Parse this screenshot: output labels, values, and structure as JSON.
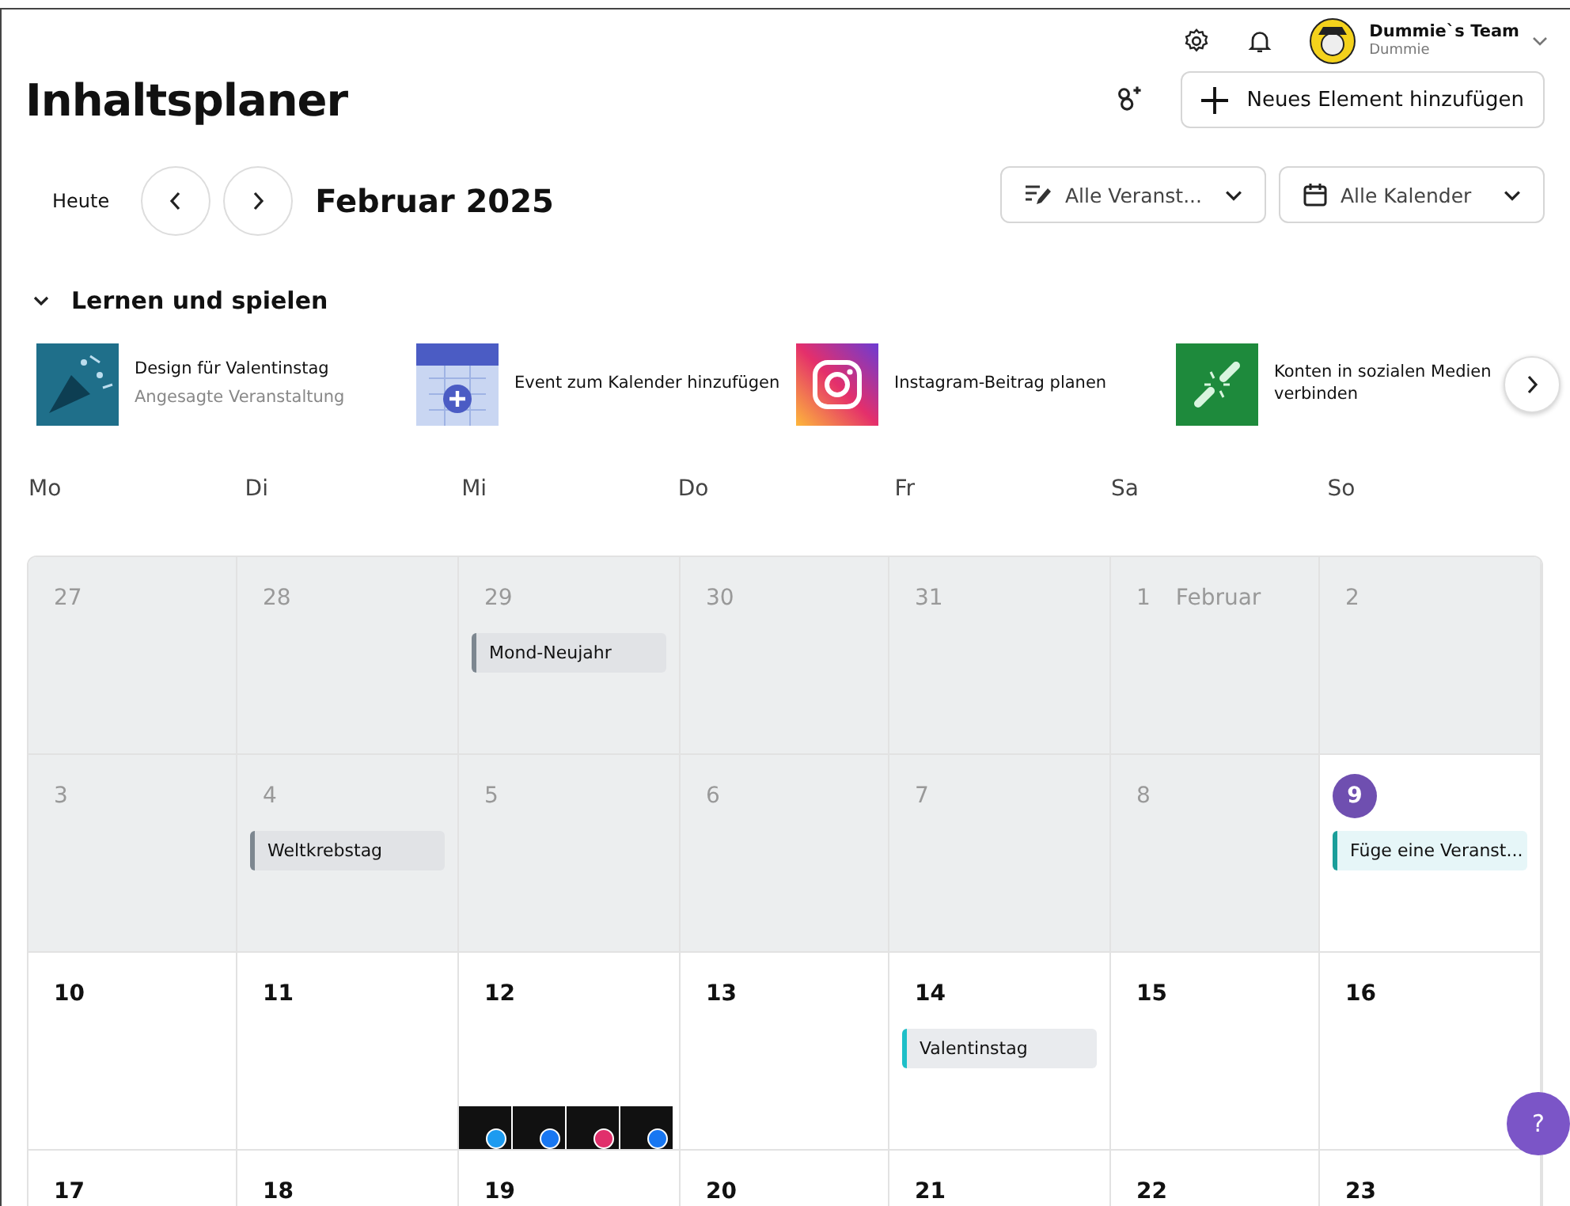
{
  "account": {
    "team": "Dummie`s Team",
    "user": "Dummie"
  },
  "title": "Inhaltsplaner",
  "new_button": "Neues Element hinzufügen",
  "today_button": "Heute",
  "month": "Februar 2025",
  "filters": [
    {
      "kind": "events",
      "label": "Alle Veranst..."
    },
    {
      "kind": "calendars",
      "label": "Alle Kalender"
    }
  ],
  "learn": {
    "title": "Lernen und spielen",
    "expanded": true,
    "items": [
      {
        "kind": "valentine",
        "title": "Design für Valentinstag",
        "subtitle": "Angesagte Veranstaltung"
      },
      {
        "kind": "calendar",
        "title": "Event zum Kalender hinzufügen"
      },
      {
        "kind": "instagram",
        "title": "Instagram-Beitrag planen"
      },
      {
        "kind": "link",
        "title": "Konten in sozialen Medien verbinden"
      }
    ]
  },
  "weekdays": [
    "Mo",
    "Di",
    "Mi",
    "Do",
    "Fr",
    "Sa",
    "So"
  ],
  "weeks": [
    [
      {
        "label": "27",
        "past": true,
        "today": false
      },
      {
        "label": "28",
        "past": true,
        "today": false
      },
      {
        "label": "29",
        "past": true,
        "today": false,
        "events": [
          {
            "title": "Mond-Neujahr",
            "color": "#7d8790"
          }
        ]
      },
      {
        "label": "30",
        "past": true,
        "today": false
      },
      {
        "label": "31",
        "past": true,
        "today": false
      },
      {
        "label": "1",
        "month": "Februar",
        "past": true,
        "today": false
      },
      {
        "label": "2",
        "past": true,
        "today": false
      }
    ],
    [
      {
        "label": "3",
        "past": true,
        "today": false
      },
      {
        "label": "4",
        "past": true,
        "today": false,
        "events": [
          {
            "title": "Weltkrebstag",
            "color": "#7d8790"
          }
        ]
      },
      {
        "label": "5",
        "past": true,
        "today": false
      },
      {
        "label": "6",
        "past": true,
        "today": false
      },
      {
        "label": "7",
        "past": true,
        "today": false
      },
      {
        "label": "8",
        "past": true,
        "today": false
      },
      {
        "label": "9",
        "past": false,
        "today": true,
        "events": [
          {
            "title": "Füge eine Veranst...",
            "color": "#1a9e9a"
          }
        ]
      }
    ],
    [
      {
        "label": "10",
        "past": false,
        "today": false
      },
      {
        "label": "11",
        "past": false,
        "today": false
      },
      {
        "label": "12",
        "past": false,
        "today": false,
        "posts": [
          {
            "kind": "twitter"
          },
          {
            "kind": "facebook"
          },
          {
            "kind": "instagram"
          },
          {
            "kind": "facebook"
          }
        ]
      },
      {
        "label": "13",
        "past": false,
        "today": false
      },
      {
        "label": "14",
        "past": false,
        "today": false,
        "events": [
          {
            "title": "Valentinstag",
            "color": "#1ebfc8"
          }
        ]
      },
      {
        "label": "15",
        "past": false,
        "today": false
      },
      {
        "label": "16",
        "past": false,
        "today": false
      }
    ],
    [
      {
        "label": "17",
        "past": false,
        "today": false
      },
      {
        "label": "18",
        "past": false,
        "today": false
      },
      {
        "label": "19",
        "past": false,
        "today": false
      },
      {
        "label": "20",
        "past": false,
        "today": false
      },
      {
        "label": "21",
        "past": false,
        "today": false
      },
      {
        "label": "22",
        "past": false,
        "today": false
      },
      {
        "label": "23",
        "past": false,
        "today": false
      }
    ]
  ],
  "help_button": "?"
}
